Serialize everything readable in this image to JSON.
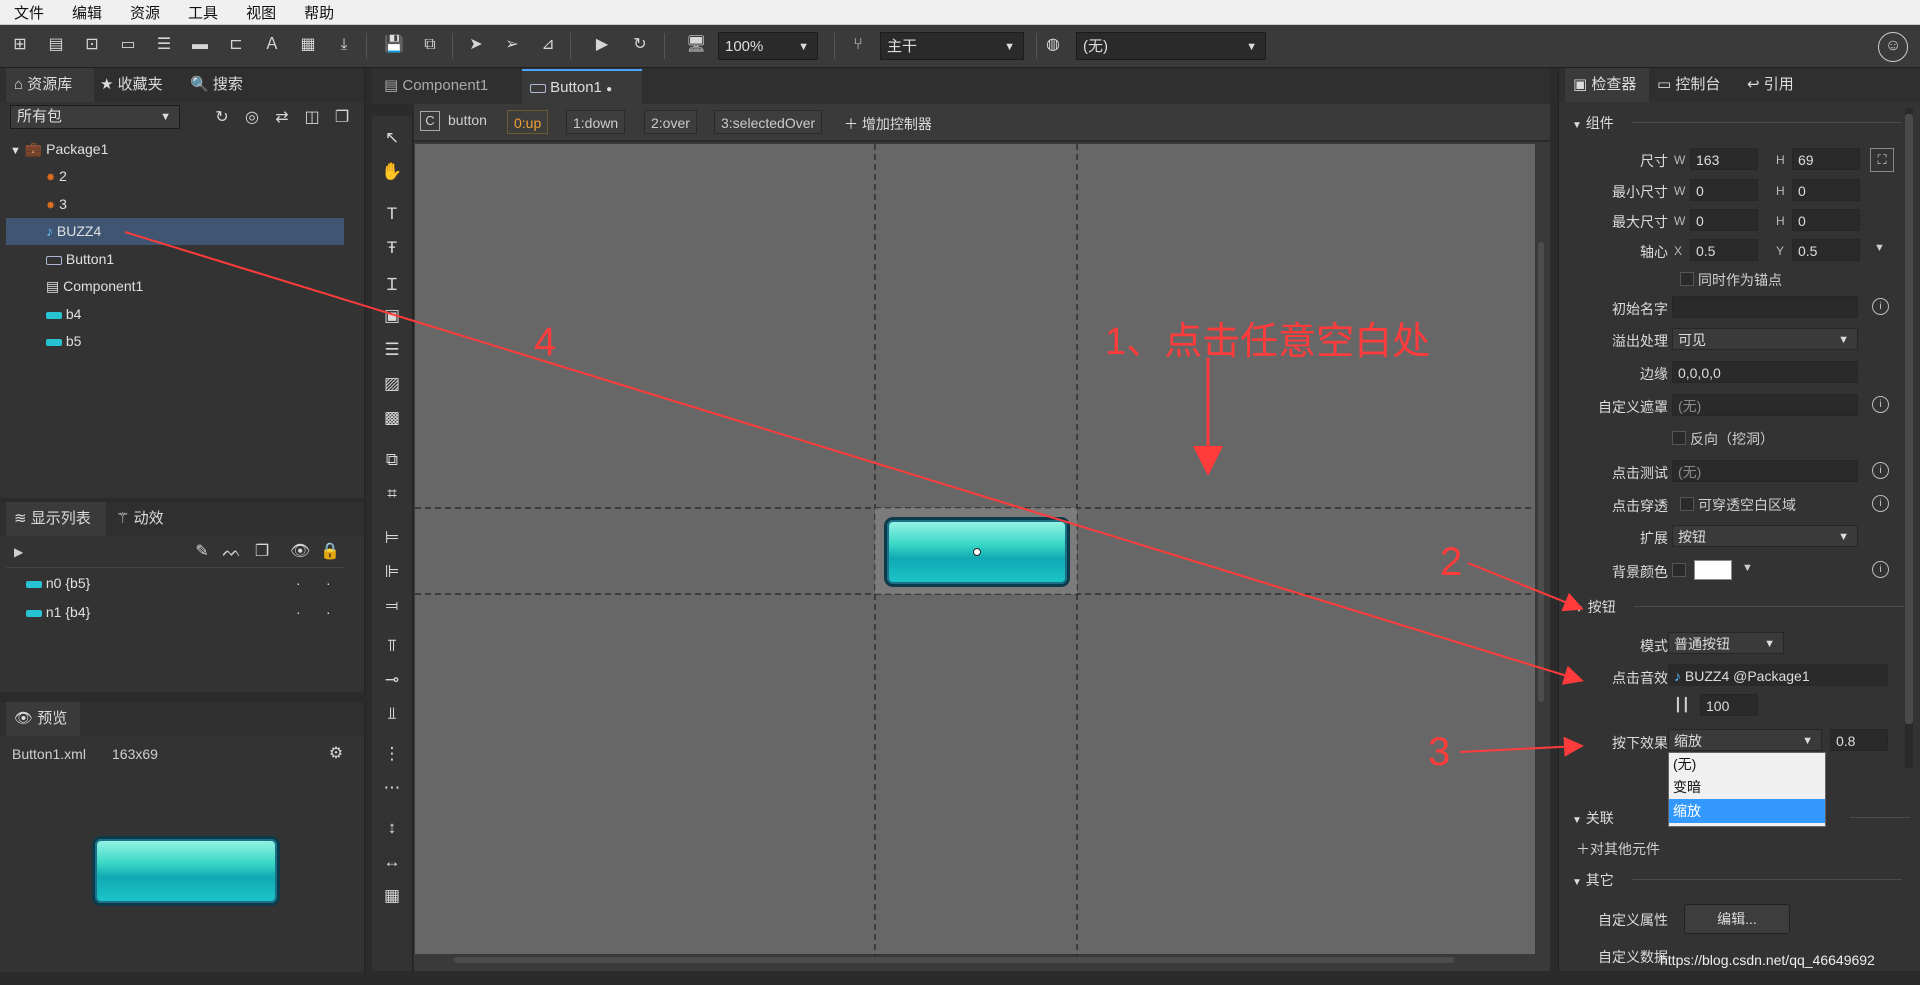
{
  "menu": [
    "文件",
    "编辑",
    "资源",
    "工具",
    "视图",
    "帮助"
  ],
  "toolbar": {
    "zoom": "100%",
    "branch": "主干",
    "language": "(无)"
  },
  "left_tabs": {
    "library": "资源库",
    "favorites": "收藏夹",
    "search": "搜索"
  },
  "package_filter": "所有包",
  "tree": {
    "root": "Package1",
    "items": [
      {
        "label": "2",
        "icon": "image-icon"
      },
      {
        "label": "3",
        "icon": "image-icon"
      },
      {
        "label": "BUZZ4",
        "icon": "music-note-icon"
      },
      {
        "label": "Button1",
        "icon": "button-icon"
      },
      {
        "label": "Component1",
        "icon": "component-icon"
      },
      {
        "label": "b4",
        "icon": "button-icon"
      },
      {
        "label": "b5",
        "icon": "button-icon"
      }
    ]
  },
  "display_tabs": {
    "list": "显示列表",
    "effects": "动效"
  },
  "display_list": [
    {
      "label": "n0 {b5}"
    },
    {
      "label": "n1 {b4}"
    }
  ],
  "preview": {
    "tab": "预览",
    "file": "Button1.xml",
    "size": "163x69"
  },
  "doc_tabs": [
    {
      "label": "Component1"
    },
    {
      "label": "Button1"
    }
  ],
  "controller": {
    "type_badge": "C",
    "name": "button",
    "states": [
      "0:up",
      "1:down",
      "2:over",
      "3:selectedOver"
    ],
    "add": "增加控制器"
  },
  "annotations": {
    "a1": "1、点击任意空白处",
    "a2": "2",
    "a3": "3",
    "a4": "4"
  },
  "inspector": {
    "tabs": {
      "inspector": "检查器",
      "console": "控制台",
      "refs": "引用"
    },
    "sections": {
      "component": "组件",
      "button": "按钮",
      "relation": "关联",
      "other": "其它"
    },
    "size": {
      "label": "尺寸",
      "w": "163",
      "h": "69"
    },
    "min_size": {
      "label": "最小尺寸",
      "w": "0",
      "h": "0"
    },
    "max_size": {
      "label": "最大尺寸",
      "w": "0",
      "h": "0"
    },
    "pivot": {
      "label": "轴心",
      "x": "0.5",
      "y": "0.5",
      "anchor": "同时作为锚点"
    },
    "init_name": {
      "label": "初始名字",
      "value": ""
    },
    "overflow": {
      "label": "溢出处理",
      "value": "可见"
    },
    "margin": {
      "label": "边缘",
      "value": "0,0,0,0"
    },
    "mask": {
      "label": "自定义遮罩",
      "value": "(无)",
      "reverse": "反向（挖洞）"
    },
    "hit_test": {
      "label": "点击测试",
      "value": "(无)"
    },
    "click_through": {
      "label": "点击穿透",
      "value": "可穿透空白区域"
    },
    "extension": {
      "label": "扩展",
      "value": "按钮"
    },
    "bg_color": {
      "label": "背景颜色",
      "value": "#ffffff"
    },
    "mode": {
      "label": "模式",
      "value": "普通按钮"
    },
    "sound": {
      "label": "点击音效",
      "value": "BUZZ4 @Package1",
      "volume": "100"
    },
    "down_effect": {
      "label": "按下效果",
      "value": "缩放",
      "amount": "0.8",
      "options": [
        "(无)",
        "变暗",
        "缩放"
      ]
    },
    "relation_add": "对其他元件",
    "custom_props": {
      "label": "自定义属性",
      "button": "编辑..."
    },
    "custom_data": {
      "label": "自定义数据"
    }
  },
  "watermark": "https://blog.csdn.net/qq_46649692"
}
